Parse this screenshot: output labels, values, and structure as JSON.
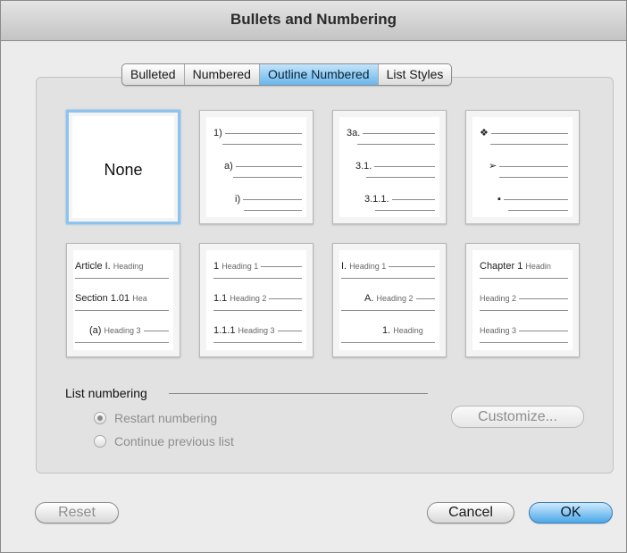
{
  "dialog": {
    "title": "Bullets and Numbering"
  },
  "tabs": [
    {
      "label": "Bulleted",
      "active": false
    },
    {
      "label": "Numbered",
      "active": false
    },
    {
      "label": "Outline Numbered",
      "active": true
    },
    {
      "label": "List Styles",
      "active": false
    }
  ],
  "tiles": {
    "none": {
      "label": "None",
      "selected": true
    },
    "tile2": {
      "levels": [
        "1)",
        "a)",
        "i)"
      ]
    },
    "tile3": {
      "levels": [
        "3a.",
        "3.1.",
        "3.1.1."
      ]
    },
    "tile4": {
      "bullet_icons": [
        "diamond-bullet-icon",
        "arrowhead-bullet-icon",
        "square-bullet-icon"
      ],
      "glyphs": [
        "❖",
        "➢",
        "▪"
      ]
    },
    "tile5": {
      "lines": [
        {
          "num": "Article I.",
          "text": "Heading"
        },
        {
          "num": "Section 1.01",
          "text": "Hea"
        },
        {
          "num": "(a)",
          "text": "Heading 3"
        }
      ]
    },
    "tile6": {
      "lines": [
        {
          "num": "1",
          "text": "Heading 1"
        },
        {
          "num": "1.1",
          "text": "Heading 2"
        },
        {
          "num": "1.1.1",
          "text": "Heading 3"
        }
      ]
    },
    "tile7": {
      "lines": [
        {
          "num": "I.",
          "text": "Heading 1"
        },
        {
          "num": "A.",
          "text": "Heading 2"
        },
        {
          "num": "1.",
          "text": "Heading"
        }
      ]
    },
    "tile8": {
      "lines": [
        {
          "num": "Chapter 1",
          "text": "Headin"
        },
        {
          "num": "",
          "text": "Heading 2"
        },
        {
          "num": "",
          "text": "Heading 3"
        }
      ]
    }
  },
  "list_numbering": {
    "label": "List numbering",
    "options": [
      {
        "label": "Restart numbering",
        "selected": true
      },
      {
        "label": "Continue previous list",
        "selected": false
      }
    ],
    "enabled": false
  },
  "buttons": {
    "customize": "Customize...",
    "reset": "Reset",
    "cancel": "Cancel",
    "ok": "OK"
  },
  "colors": {
    "accent": "#68b6ec",
    "selected_border": "#8fc3ec"
  }
}
